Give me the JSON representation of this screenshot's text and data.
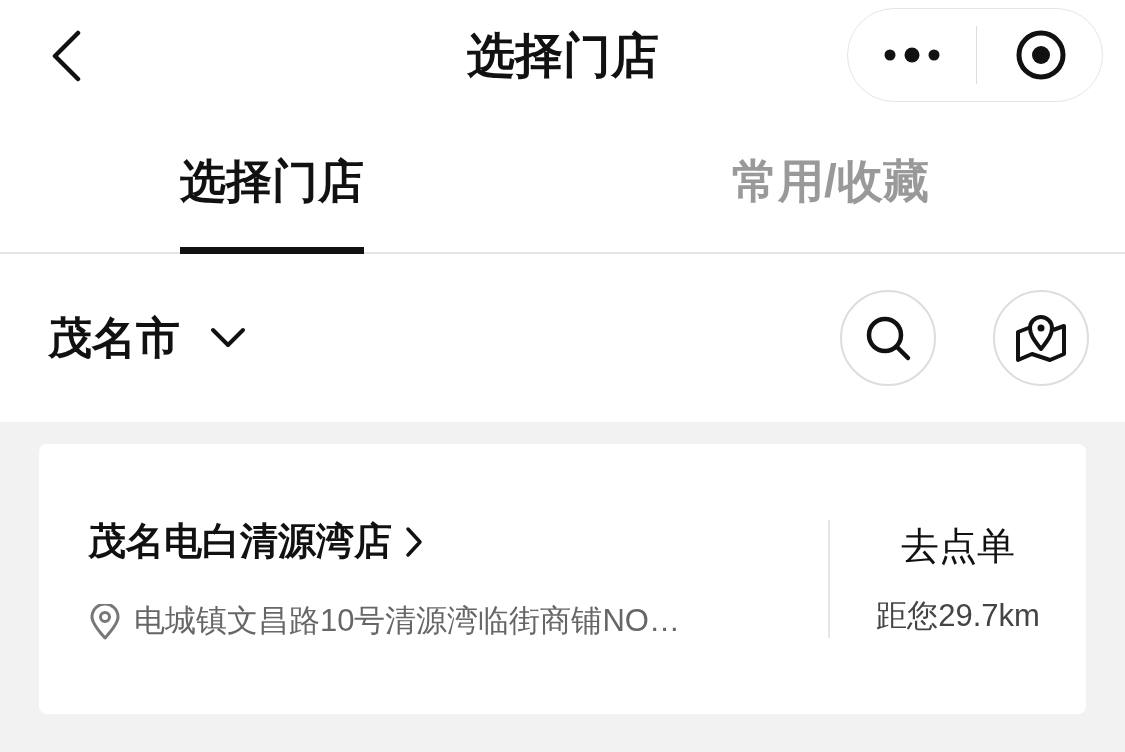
{
  "nav": {
    "title": "选择门店"
  },
  "tabs": [
    {
      "label": "选择门店",
      "selected": true
    },
    {
      "label": "常用/收藏",
      "selected": false
    }
  ],
  "city": {
    "name": "茂名市"
  },
  "stores": [
    {
      "name": "茂名电白清源湾店",
      "address": "电城镇文昌路10号清源湾临街商铺NO…",
      "action": "去点单",
      "distance": "距您29.7km"
    }
  ]
}
